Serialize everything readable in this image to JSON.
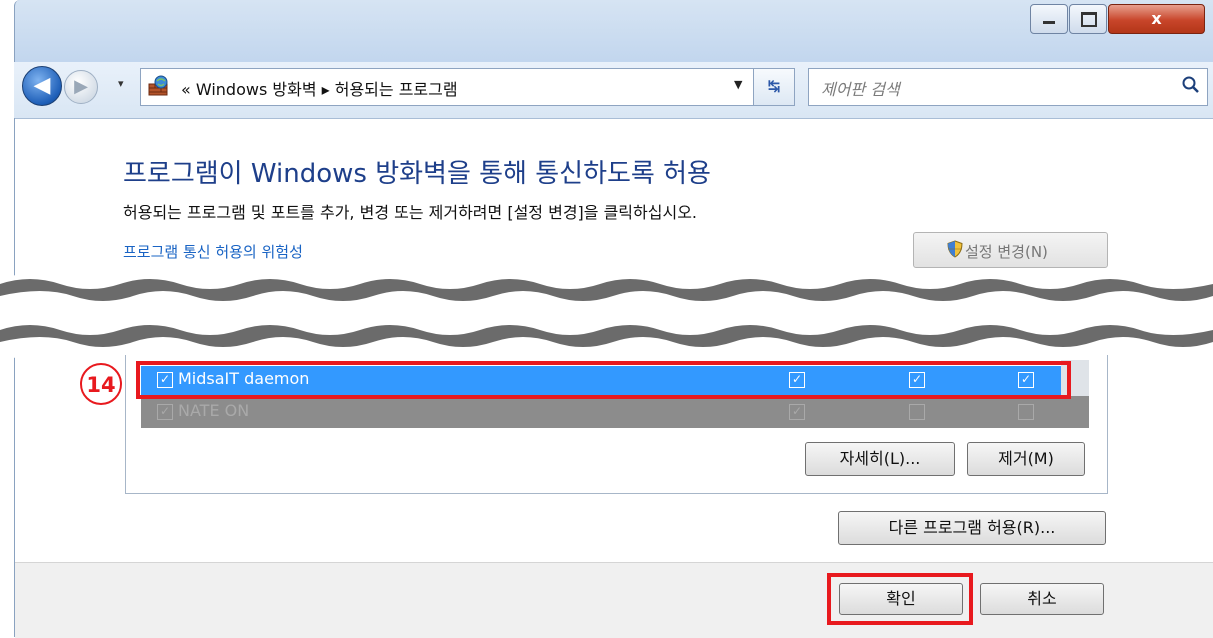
{
  "window": {
    "close_glyph": "x"
  },
  "nav": {
    "back_glyph": "◀",
    "forward_glyph": "▶",
    "history_glyph": "▾",
    "address": "« Windows 방화벽 ▸ 허용되는 프로그램",
    "address_dropdown_glyph": "▼",
    "refresh_glyph": "↹",
    "search_placeholder": "제어판 검색"
  },
  "content": {
    "heading": "프로그램이 Windows 방화벽을 통해 통신하도록 허용",
    "description": "허용되는 프로그램 및 포트를 추가, 변경 또는 제거하려면 [설정 변경]을 클릭하십시오.",
    "risk_link": "프로그램 통신 허용의 위험성",
    "change_settings_button": "설정 변경(N)"
  },
  "programs": [
    {
      "name": "MidsaIT daemon",
      "enabled": true,
      "columns": [
        true,
        true,
        true
      ],
      "selected": true
    },
    {
      "name": "NATE ON",
      "enabled": true,
      "columns": [
        true,
        false,
        false
      ],
      "selected": false
    }
  ],
  "check_glyph": "✓",
  "annotation": {
    "step_number": "14",
    "highlight_color": "#e8191e"
  },
  "buttons": {
    "details": "자세히(L)...",
    "remove": "제거(M)",
    "allow_other": "다른 프로그램 허용(R)...",
    "ok": "확인",
    "cancel": "취소"
  },
  "colors": {
    "heading": "#1e3f8a",
    "link": "#1a64c4",
    "selection": "#3399ff"
  }
}
